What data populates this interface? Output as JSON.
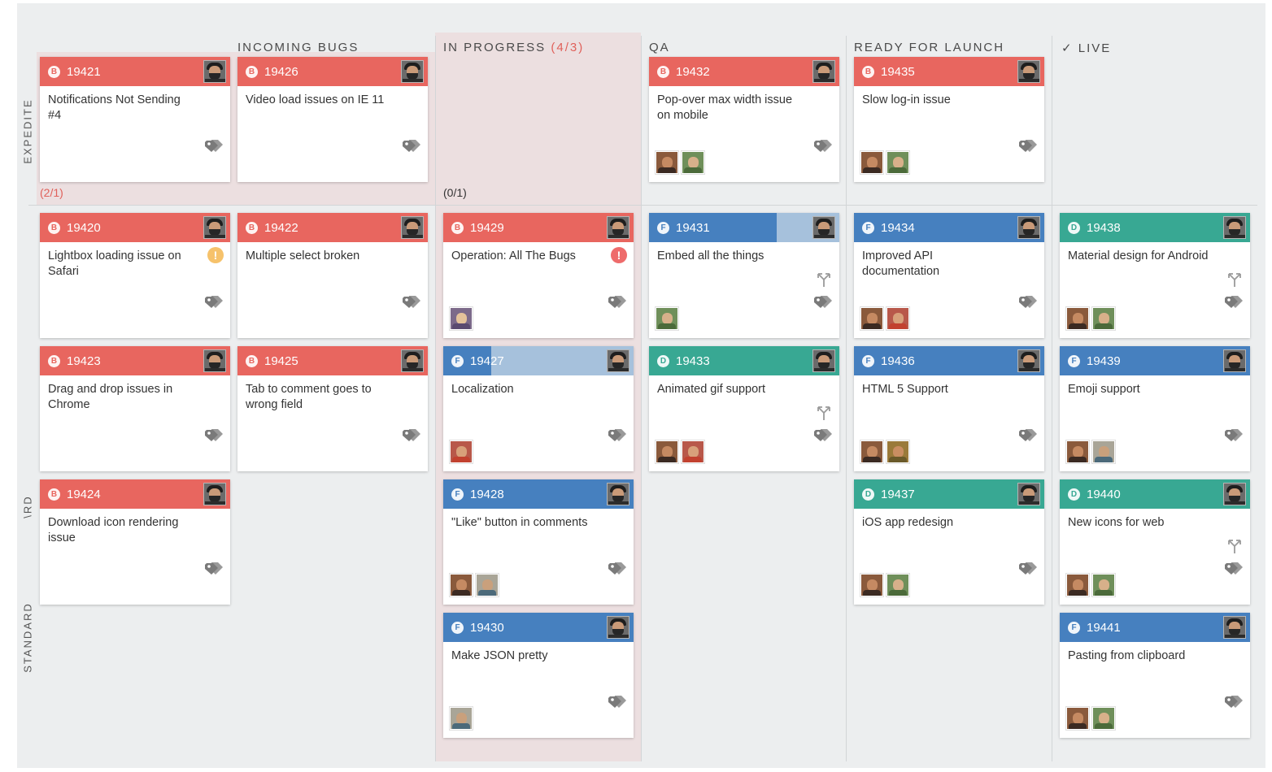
{
  "colors": {
    "bug": "#e8665f",
    "feature": "#4680bf",
    "feature_light": "#a6c1dc",
    "design": "#38a893",
    "board_bg": "#eceeef",
    "in_progress_bg": "#ecdfe0",
    "wip_alert": "#e0605a"
  },
  "columns": [
    {
      "key": "incoming",
      "label": "INCOMING BUGS",
      "wip": ""
    },
    {
      "key": "progress",
      "label": "IN PROGRESS",
      "wip": "(4/3)"
    },
    {
      "key": "qa",
      "label": "QA",
      "wip": ""
    },
    {
      "key": "ready",
      "label": "READY FOR LAUNCH",
      "wip": ""
    },
    {
      "key": "live",
      "label": "✓ LIVE",
      "wip": ""
    }
  ],
  "lanes": {
    "expedite": {
      "label": "EXPEDITE",
      "wip_left": "(2/1)",
      "wip_progress": "(0/1)"
    },
    "standard": {
      "label": "STANDARD",
      "label_clipped": "\\RD"
    }
  },
  "cards": [
    {
      "id": "19421",
      "type": "B",
      "kind": "bug",
      "title": "Notifications Not Sending #4",
      "avatars": []
    },
    {
      "id": "19426",
      "type": "B",
      "kind": "bug",
      "title": "Video load issues on IE 11",
      "avatars": []
    },
    {
      "id": "19432",
      "type": "B",
      "kind": "bug",
      "title": "Pop-over max width issue on mobile",
      "avatars": [
        "a1",
        "a2"
      ]
    },
    {
      "id": "19435",
      "type": "B",
      "kind": "bug",
      "title": "Slow log-in issue",
      "avatars": [
        "a1",
        "a2"
      ]
    },
    {
      "id": "19420",
      "type": "B",
      "kind": "bug",
      "title": "Lightbox loading issue on Safari",
      "blocker": "yellow",
      "avatars": []
    },
    {
      "id": "19422",
      "type": "B",
      "kind": "bug",
      "title": "Multiple select broken",
      "avatars": []
    },
    {
      "id": "19429",
      "type": "B",
      "kind": "bug",
      "title": "Operation: All The Bugs",
      "blocker": "red",
      "avatars": [
        "a3"
      ]
    },
    {
      "id": "19431",
      "type": "F",
      "kind": "feature",
      "progress": 0.67,
      "title": "Embed all the things",
      "split": true,
      "avatars": [
        "a2"
      ]
    },
    {
      "id": "19434",
      "type": "F",
      "kind": "feature",
      "title": "Improved API documentation",
      "avatars": [
        "a1",
        "a4"
      ]
    },
    {
      "id": "19438",
      "type": "D",
      "kind": "design",
      "title": "Material design for Android",
      "split": true,
      "avatars": [
        "a1",
        "a2"
      ]
    },
    {
      "id": "19423",
      "type": "B",
      "kind": "bug",
      "title": "Drag and drop issues in Chrome",
      "avatars": []
    },
    {
      "id": "19425",
      "type": "B",
      "kind": "bug",
      "title": "Tab to comment goes to wrong field",
      "avatars": []
    },
    {
      "id": "19427",
      "type": "F",
      "kind": "feature",
      "progress": 0.25,
      "title": "Localization",
      "avatars": [
        "a4"
      ]
    },
    {
      "id": "19433",
      "type": "D",
      "kind": "design",
      "title": "Animated gif support",
      "split": true,
      "avatars": [
        "a1",
        "a4"
      ]
    },
    {
      "id": "19436",
      "type": "F",
      "kind": "feature",
      "title": "HTML 5 Support",
      "avatars": [
        "a1",
        "a5"
      ]
    },
    {
      "id": "19439",
      "type": "F",
      "kind": "feature",
      "title": "Emoji support",
      "avatars": [
        "a1",
        "a6"
      ]
    },
    {
      "id": "19424",
      "type": "B",
      "kind": "bug",
      "title": "Download icon rendering issue",
      "avatars": []
    },
    {
      "id": "19428",
      "type": "F",
      "kind": "feature",
      "title": "\"Like\" button in comments",
      "avatars": [
        "a1",
        "a6"
      ]
    },
    {
      "id": "19437",
      "type": "D",
      "kind": "design",
      "title": "iOS app redesign",
      "avatars": [
        "a1",
        "a2"
      ]
    },
    {
      "id": "19440",
      "type": "D",
      "kind": "design",
      "title": "New icons for web",
      "split": true,
      "avatars": [
        "a1",
        "a2"
      ]
    },
    {
      "id": "19430",
      "type": "F",
      "kind": "feature",
      "title": "Make JSON pretty",
      "avatars": [
        "a6"
      ]
    },
    {
      "id": "19441",
      "type": "F",
      "kind": "feature",
      "title": "Pasting from clipboard",
      "avatars": [
        "a1",
        "a2"
      ]
    }
  ],
  "avatar_styles": {
    "a1": {
      "bg": "#8a5a3c",
      "face": "#c58a62",
      "body": "#3b2a22"
    },
    "a2": {
      "bg": "#6f8f5a",
      "face": "#d7b08a",
      "body": "#4b6a3a"
    },
    "a3": {
      "bg": "#7c6a8a",
      "face": "#e4c29a",
      "body": "#5a4a70"
    },
    "a4": {
      "bg": "#b8584a",
      "face": "#d8a07a",
      "body": "#c2412f"
    },
    "a5": {
      "bg": "#9a7a3a",
      "face": "#c98e62",
      "body": "#6a5a2a"
    },
    "a6": {
      "bg": "#a9a597",
      "face": "#c9a07c",
      "body": "#4c6a7a"
    }
  }
}
